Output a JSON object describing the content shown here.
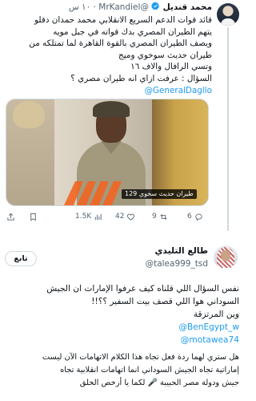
{
  "parent_tweet": {
    "author_name": "محمد قنديل",
    "verified": true,
    "handle": "@MrKandiel",
    "time": "١٠ س",
    "dot": "·",
    "text_lines": [
      "قائد قوات الدعم السريع الانقلابي محمد حمدان دقلو",
      "يتهم الطيران المصري بدك قواته في جبل مويه",
      "ويصف الطيران المصري بالقوة القاهرة لما تمتلكه من",
      "طيران حديث سوخوي وميج",
      "وتسي الرافال والاف ١٦",
      "السؤال : عرفت ازاي انه طيران مصري ؟"
    ],
    "mention": "@GeneralDagllo",
    "media": {
      "caption": "طيران حديث سخوي 129"
    },
    "actions": {
      "replies": "6",
      "retweets": "9",
      "likes": "42",
      "views": "1.5K"
    }
  },
  "main_tweet": {
    "author_name": "طالع التليدي",
    "handle": "@talea999_tsd",
    "follow_label": "تابع",
    "text_lines": [
      "نفس السؤال اللي قلناه كيف عرفوا الإمارات ان الجيش",
      "السوداني هوا اللي قصف بيت السفير ؟؟!!",
      "وين المرتزقة"
    ],
    "mentions": [
      "@BenEgypt_w",
      "@motawea74"
    ],
    "text_lines_2": [
      "هل ستري لهما ردة فعل تجاه هذا الكلام الاتهامات الآن ليست",
      "إماراتية تجاه الجيش السوداني انما اتهامات انقلابية تجاه",
      "جيش ودولة مصر الحبيبة 🎤 لكما يا أرخص الخلق"
    ]
  },
  "colors": {
    "link": "#1d9bf0",
    "muted": "#536471",
    "text": "#0f1419",
    "verified": "#1d9bf0",
    "watermark": "#f26522"
  },
  "icons": [
    "verified-badge-icon",
    "reply-icon",
    "retweet-icon",
    "like-icon",
    "views-icon",
    "bookmark-icon",
    "share-icon"
  ]
}
